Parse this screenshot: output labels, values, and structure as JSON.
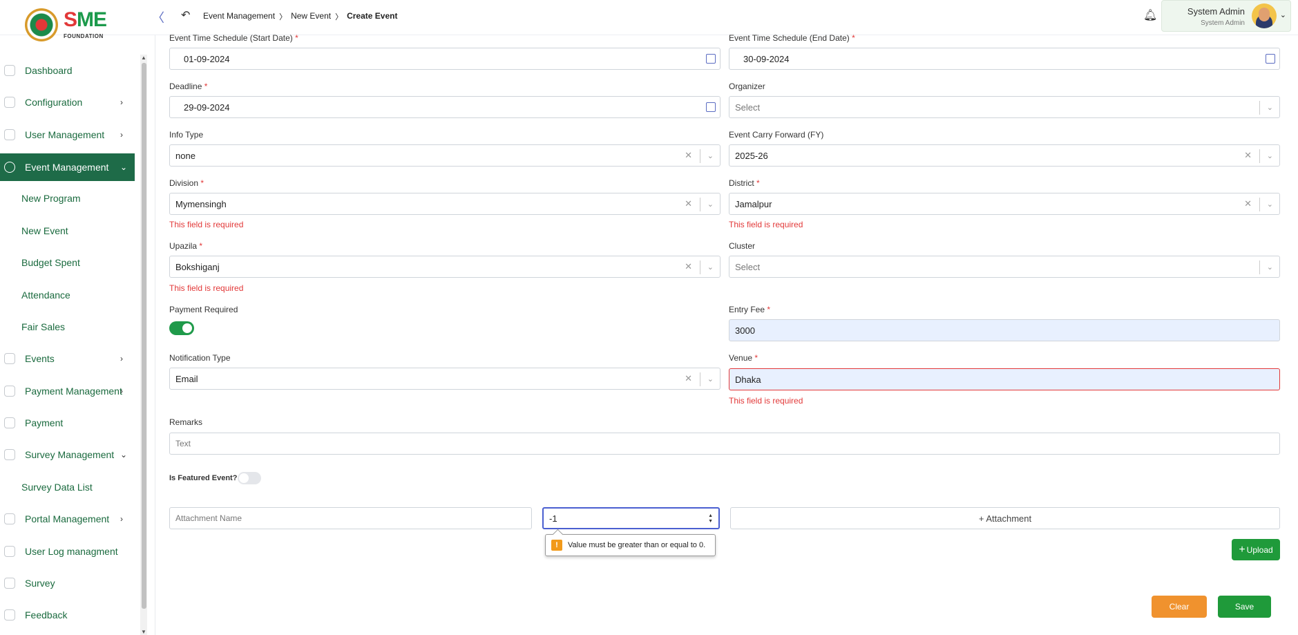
{
  "brand": {
    "logo_text_1": "S",
    "logo_text_2": "ME",
    "logo_sub": "FOUNDATION"
  },
  "header": {
    "breadcrumb": [
      "Event Management",
      "New Event",
      "Create Event"
    ],
    "user_name": "System Admin",
    "user_role": "System Admin"
  },
  "sidebar": {
    "items": [
      {
        "label": "Dashboard",
        "icon": "dashboard-icon"
      },
      {
        "label": "Configuration",
        "icon": "config-icon"
      },
      {
        "label": "User Management",
        "icon": "user-icon"
      },
      {
        "label": "Event Management",
        "icon": "event-icon"
      },
      {
        "label": "New Program"
      },
      {
        "label": "New Event"
      },
      {
        "label": "Budget Spent"
      },
      {
        "label": "Attendance"
      },
      {
        "label": "Fair Sales"
      },
      {
        "label": "Events",
        "icon": "events-icon"
      },
      {
        "label": "Payment Management",
        "icon": "payment-mgmt-icon"
      },
      {
        "label": "Payment",
        "icon": "payment-icon"
      },
      {
        "label": "Survey Management",
        "icon": "survey-mgmt-icon"
      },
      {
        "label": "Survey Data List"
      },
      {
        "label": "Portal Management",
        "icon": "portal-icon"
      },
      {
        "label": "User Log managment",
        "icon": "log-icon"
      },
      {
        "label": "Survey",
        "icon": "survey-icon"
      },
      {
        "label": "Feedback",
        "icon": "feedback-icon"
      }
    ]
  },
  "form": {
    "start_date_label": "Event Time Schedule (Start Date)",
    "start_date_value": "01-09-2024",
    "end_date_label": "Event Time Schedule (End Date)",
    "end_date_value": "30-09-2024",
    "deadline_label": "Deadline",
    "deadline_value": "29-09-2024",
    "organizer_label": "Organizer",
    "organizer_placeholder": "Select",
    "info_type_label": "Info Type",
    "info_type_value": "none",
    "carry_forward_label": "Event Carry Forward (FY)",
    "carry_forward_value": "2025-26",
    "division_label": "Division",
    "division_value": "Mymensingh",
    "district_label": "District",
    "district_value": "Jamalpur",
    "upazila_label": "Upazila",
    "upazila_value": "Bokshiganj",
    "cluster_label": "Cluster",
    "cluster_placeholder": "Select",
    "payment_required_label": "Payment Required",
    "entry_fee_label": "Entry Fee",
    "entry_fee_value": "3000",
    "notification_type_label": "Notification Type",
    "notification_type_value": "Email",
    "venue_label": "Venue",
    "venue_value": "Dhaka",
    "remarks_label": "Remarks",
    "remarks_placeholder": "Text",
    "featured_label": "Is Featured Event?",
    "required_error": "This field is required",
    "attachment_name_placeholder": "Attachment Name",
    "attachment_number_value": "-1",
    "attachment_button": "+ Attachment",
    "validation_tooltip": "Value must be greater than or equal to 0.",
    "upload_button": "Upload",
    "clear_button": "Clear",
    "save_button": "Save"
  },
  "colors": {
    "primary": "#1e6b48",
    "error": "#e23838",
    "clear": "#f0922e",
    "save": "#1f9a3a"
  }
}
